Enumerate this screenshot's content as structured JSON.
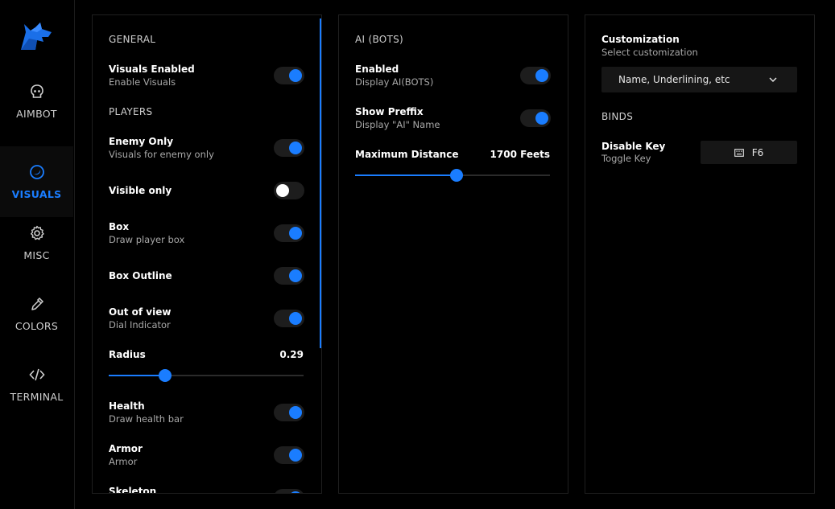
{
  "sidebar": {
    "items": [
      {
        "label": "AIMBOT",
        "icon": "skull-icon"
      },
      {
        "label": "VISUALS",
        "icon": "moon-icon",
        "active": true
      },
      {
        "label": "MISC",
        "icon": "gear-icon"
      },
      {
        "label": "COLORS",
        "icon": "eyedropper-icon"
      },
      {
        "label": "TERMINAL",
        "icon": "code-icon"
      }
    ],
    "accent": "#1a7dff"
  },
  "general_panel": {
    "general_title": "GENERAL",
    "visuals_enabled": {
      "title": "Visuals Enabled",
      "sub": "Enable Visuals",
      "on": true
    },
    "players_title": "PLAYERS",
    "enemy_only": {
      "title": "Enemy Only",
      "sub": "Visuals for enemy only",
      "on": true
    },
    "visible_only": {
      "title": "Visible only",
      "on": false
    },
    "box": {
      "title": "Box",
      "sub": "Draw player box",
      "on": true
    },
    "box_outline": {
      "title": "Box Outline",
      "on": true
    },
    "out_of_view": {
      "title": "Out of view",
      "sub": "Dial Indicator",
      "on": true
    },
    "radius": {
      "title": "Radius",
      "value": "0.29",
      "fraction": 0.29
    },
    "health": {
      "title": "Health",
      "sub": "Draw health bar",
      "on": true
    },
    "armor": {
      "title": "Armor",
      "sub": "Armor",
      "on": true
    },
    "skeleton": {
      "title": "Skeleton",
      "on": true
    }
  },
  "ai_panel": {
    "title": "AI (BOTS)",
    "enabled": {
      "title": "Enabled",
      "sub": "Display AI(BOTS)",
      "on": true
    },
    "show_prefix": {
      "title": "Show Preffix",
      "sub": "Display \"AI\" Name",
      "on": true
    },
    "max_distance": {
      "title": "Maximum Distance",
      "value": "1700 Feets",
      "fraction": 0.52
    }
  },
  "custom_panel": {
    "title": "Customization",
    "sub": "Select customization",
    "dropdown_value": "Name, Underlining, etc",
    "binds_title": "BINDS",
    "disable_key": {
      "title": "Disable Key",
      "sub": "Toggle Key",
      "key": "F6",
      "icon": "keyboard-icon"
    }
  }
}
